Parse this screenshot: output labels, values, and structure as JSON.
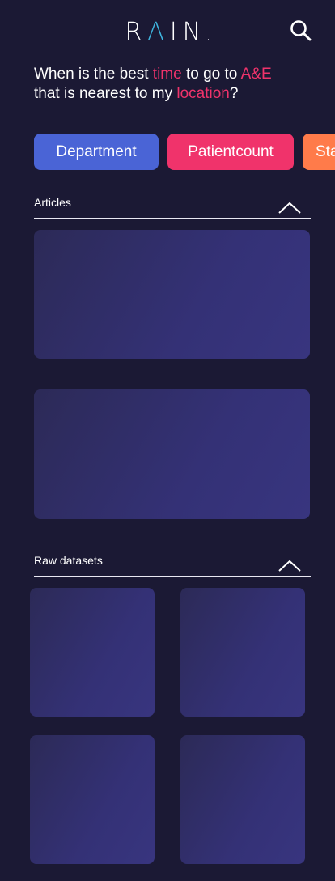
{
  "header": {
    "logo": {
      "r": "R",
      "a": "Λ",
      "rest": "IN",
      "dot": "."
    },
    "search_icon": "search-icon"
  },
  "question": {
    "part1": "When is the best ",
    "kw1": "time",
    "part2": " to go to ",
    "kw2": "A&E",
    "part3": " that is nearest to my ",
    "kw3": "location",
    "part4": "?"
  },
  "chips": [
    {
      "label": "Department",
      "color": "#4a64d6"
    },
    {
      "label": "Patientcount",
      "color": "#f0336b"
    },
    {
      "label": "Sta",
      "color": "#ff7b4a"
    }
  ],
  "sections": {
    "articles": {
      "title": "Articles",
      "toggle_icon": "chevron-up-icon",
      "cards": 2
    },
    "datasets": {
      "title": "Raw datasets",
      "toggle_icon": "chevron-up-icon",
      "cards": 4
    }
  },
  "colors": {
    "background": "#1b1934",
    "highlight": "#f0336b",
    "logo_accent": "#3fb6e0"
  }
}
